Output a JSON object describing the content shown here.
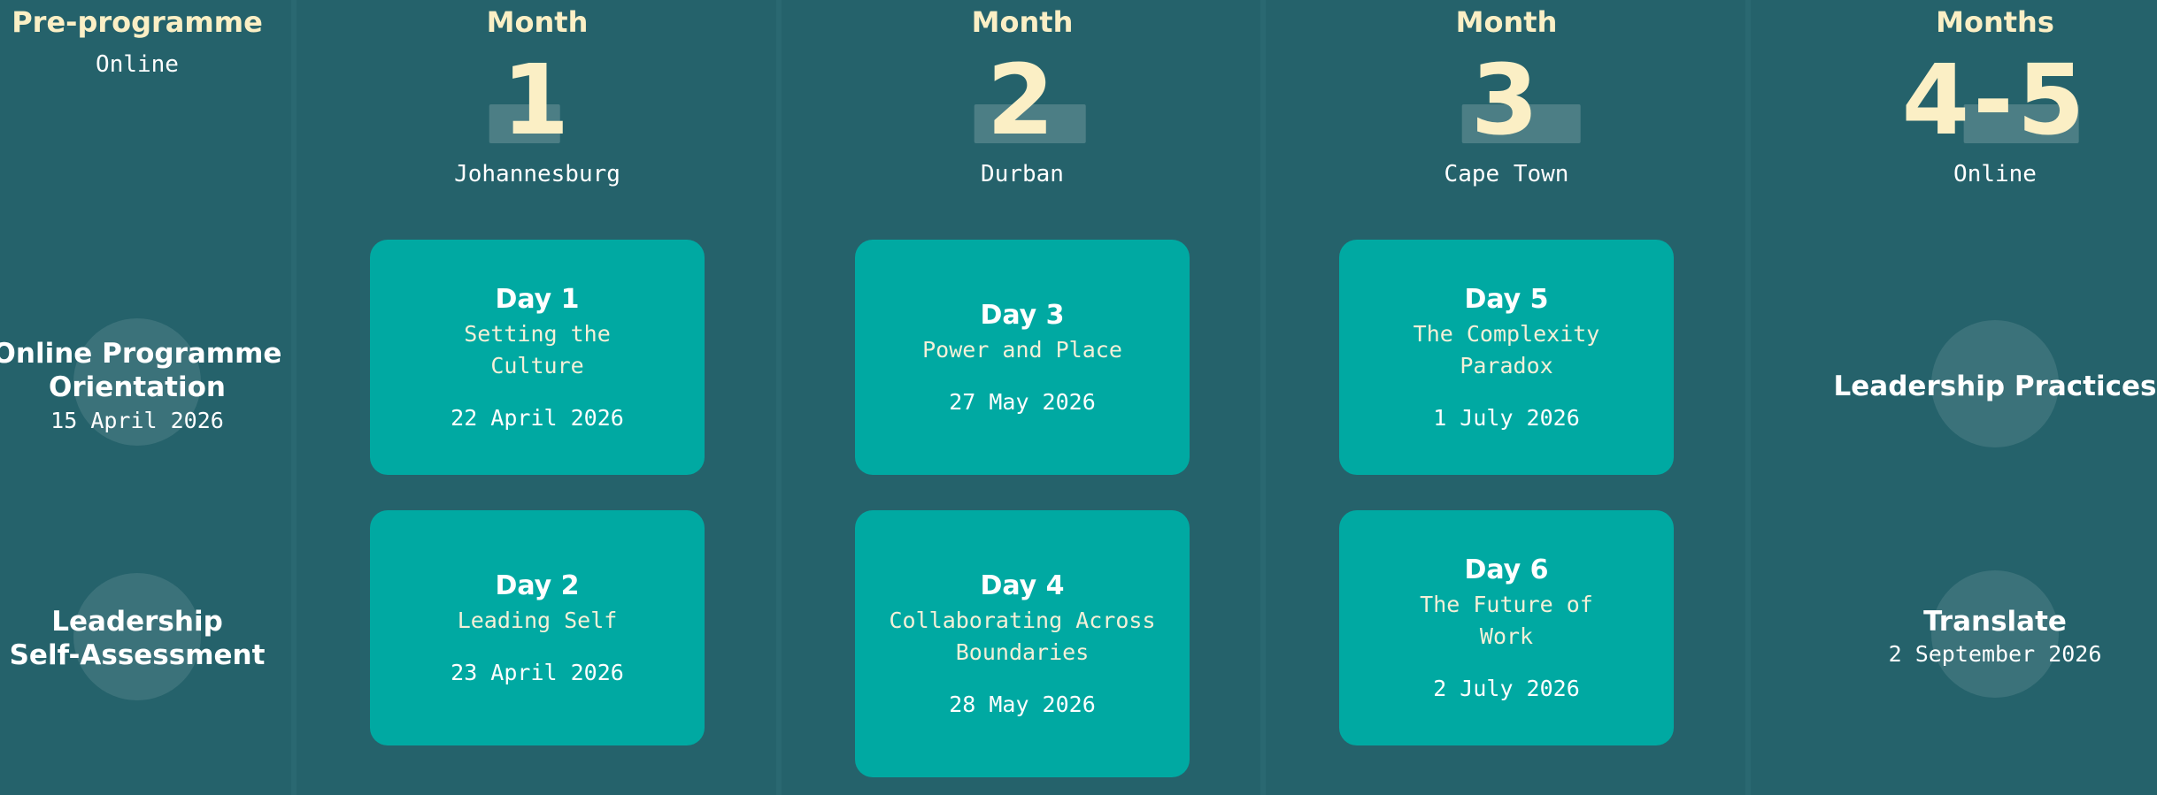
{
  "preprogramme": {
    "title": "Pre-programme",
    "location": "Online",
    "items": [
      {
        "title_line1": "Online Programme",
        "title_line2": "Orientation",
        "date": "15 April 2026"
      },
      {
        "title_line1": "Leadership",
        "title_line2": "Self-Assessment"
      }
    ]
  },
  "months": [
    {
      "label": "Month",
      "number": "1",
      "location": "Johannesburg",
      "days": [
        {
          "day": "Day 1",
          "topic_line1": "Setting the",
          "topic_line2": "Culture",
          "date": "22 April 2026"
        },
        {
          "day": "Day 2",
          "topic_line1": "Leading Self",
          "topic_line2": "",
          "date": "23 April 2026"
        }
      ]
    },
    {
      "label": "Month",
      "number": "2",
      "location": "Durban",
      "days": [
        {
          "day": "Day 3",
          "topic_line1": "Power and Place",
          "topic_line2": "",
          "date": "27 May 2026"
        },
        {
          "day": "Day 4",
          "topic_line1": "Collaborating Across",
          "topic_line2": "Boundaries",
          "date": "28 May 2026"
        }
      ]
    },
    {
      "label": "Month",
      "number": "3",
      "location": "Cape Town",
      "days": [
        {
          "day": "Day 5",
          "topic_line1": "The Complexity",
          "topic_line2": "Paradox",
          "date": "1 July 2026"
        },
        {
          "day": "Day 6",
          "topic_line1": "The Future of",
          "topic_line2": "Work",
          "date": "2 July 2026"
        }
      ]
    }
  ],
  "final": {
    "label": "Months",
    "number": "4-5",
    "location": "Online",
    "items": [
      {
        "title": "Leadership Practices"
      },
      {
        "title": "Translate",
        "date": "2 September 2026"
      }
    ]
  },
  "colors": {
    "background": "#25626b",
    "card": "#00a9a2",
    "accent_cream": "#fbefc5"
  }
}
